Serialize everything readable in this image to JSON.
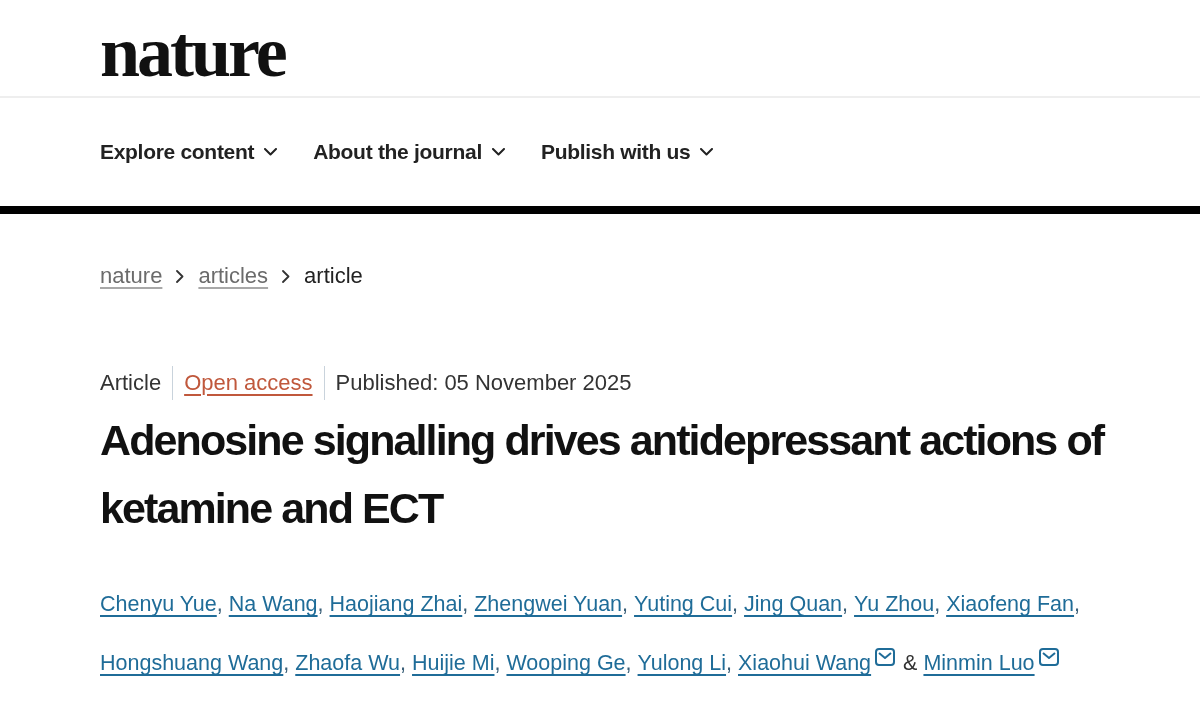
{
  "header": {
    "logo": "nature"
  },
  "nav": [
    {
      "label": "Explore content",
      "dropdown": true
    },
    {
      "label": "About the journal",
      "dropdown": true
    },
    {
      "label": "Publish with us",
      "dropdown": true
    }
  ],
  "breadcrumb": [
    {
      "label": "nature",
      "current": false
    },
    {
      "label": "articles",
      "current": false
    },
    {
      "label": "article",
      "current": true
    }
  ],
  "meta": {
    "article_type": "Article",
    "access": "Open access",
    "published": "Published: 05 November 2025"
  },
  "title": "Adenosine signalling drives antidepressant actions of ketamine and ECT",
  "authors": [
    {
      "name": "Chenyu Yue",
      "email": false,
      "separator": ","
    },
    {
      "name": "Na Wang",
      "email": false,
      "separator": ","
    },
    {
      "name": "Haojiang Zhai",
      "email": false,
      "separator": ","
    },
    {
      "name": "Zhengwei Yuan",
      "email": false,
      "separator": ","
    },
    {
      "name": "Yuting Cui",
      "email": false,
      "separator": ","
    },
    {
      "name": "Jing Quan",
      "email": false,
      "separator": ","
    },
    {
      "name": "Yu Zhou",
      "email": false,
      "separator": ","
    },
    {
      "name": "Xiaofeng Fan",
      "email": false,
      "separator": ","
    },
    {
      "name": "Hongshuang Wang",
      "email": false,
      "separator": ","
    },
    {
      "name": "Zhaofa Wu",
      "email": false,
      "separator": ","
    },
    {
      "name": "Huijie Mi",
      "email": false,
      "separator": ","
    },
    {
      "name": "Wooping Ge",
      "email": false,
      "separator": ","
    },
    {
      "name": "Yulong Li",
      "email": false,
      "separator": ","
    },
    {
      "name": "Xiaohui Wang",
      "email": true,
      "separator": "&"
    },
    {
      "name": "Minmin Luo",
      "email": true
    }
  ]
}
